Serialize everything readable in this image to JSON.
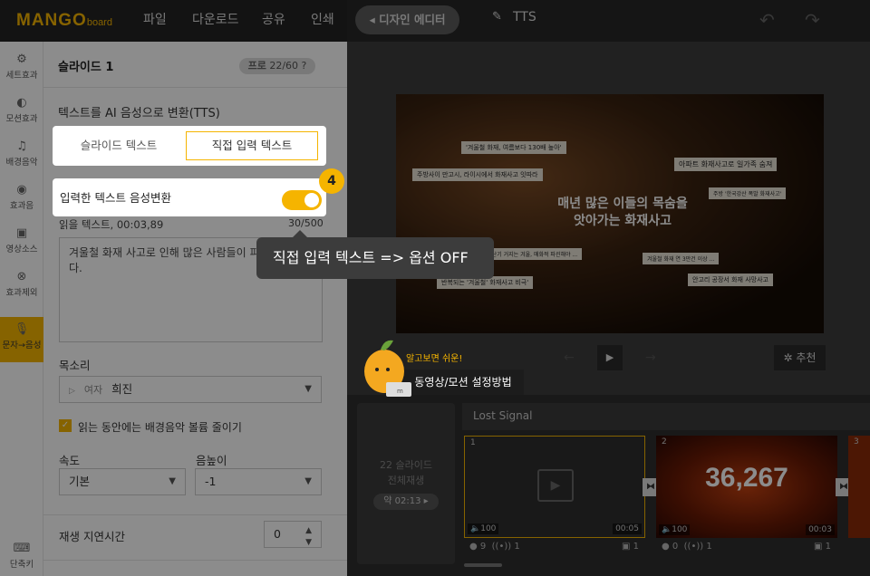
{
  "header": {
    "logo_main": "MANGO",
    "logo_sub": "board",
    "menu": [
      "파일",
      "다운로드",
      "공유",
      "인쇄"
    ],
    "design_editor": "◂ 디자인 에디터",
    "doc_title": "TTS"
  },
  "sidebar": {
    "items": [
      {
        "label": "세트효과",
        "icon": "⚙"
      },
      {
        "label": "모션효과",
        "icon": "◐"
      },
      {
        "label": "배경음악",
        "icon": "♫"
      },
      {
        "label": "효과음",
        "icon": "◉"
      },
      {
        "label": "영상소스",
        "icon": "▣"
      },
      {
        "label": "효과제외",
        "icon": "⊗"
      },
      {
        "label": "문자→음성",
        "icon": "🎙"
      },
      {
        "label": "단축키",
        "icon": "⌨"
      }
    ]
  },
  "panel": {
    "title": "슬라이드 1",
    "badge_pro": "프로",
    "badge_count": "22/60",
    "section_title": "텍스트를 AI 음성으로 변환(TTS)",
    "tab_slide_text": "슬라이드 텍스트",
    "tab_direct_text": "직접 입력 텍스트",
    "toggle_label": "입력한 텍스트 음성변환",
    "read_text_label": "읽을 텍스트, 00:03,89",
    "char_count": "30/500",
    "textarea_value": "겨울철 화재 사고로 인해 많은 사람들이 피해를 봅니다.",
    "voice_label": "목소리",
    "voice_gender": "여자",
    "voice_name": "희진",
    "bgm_reduce_label": "읽는 동안에는 배경음악 볼륨 줄이기",
    "speed_label": "속도",
    "speed_value": "기본",
    "pitch_label": "음높이",
    "pitch_value": "-1",
    "delay_label": "재생 지연시간",
    "delay_value": "0"
  },
  "tutorial": {
    "step_number": "4",
    "tooltip": "직접 입력 텍스트    => 옵션 OFF"
  },
  "canvas": {
    "slide_title_line1": "매년 많은 이들의 목숨을",
    "slide_title_line2": "앗아가는 화재사고",
    "tags": [
      "'겨울철 화재, 여름보다 130배 높아'",
      "주방사이 만고시, 라이시에서 화재사고 잇따라",
      "아파트 화재사고로 일가족 숨져",
      "주방 '한국강산 폭발 화재사고'",
      "선불으로 '할레난기 거지는 겨울, 매화적 파괸해야 ...",
      "겨울철 화재 연 3만건 이상 ...",
      "반복되는 '겨울철' 화재사고 비극'",
      "안고리 공장서 화재 사망사고"
    ],
    "recommend": "추천",
    "mascot_hint": "알고보면 쉬운!",
    "help_button": "동영상/모션 설정방법"
  },
  "timeline": {
    "total_label_line1": "22 슬라이드",
    "total_label_line2": "전체재생",
    "total_time": "약 02:13 ▸",
    "track_name": "Lost Signal",
    "slides": [
      {
        "num": "1",
        "volume": "100",
        "duration": "00:05",
        "motion": "9",
        "sfx": "1",
        "layers": "1"
      },
      {
        "num": "2",
        "big_text": "36,267",
        "volume": "100",
        "duration": "00:03",
        "motion": "0",
        "sfx": "1",
        "layers": "1"
      },
      {
        "num": "3"
      }
    ]
  }
}
